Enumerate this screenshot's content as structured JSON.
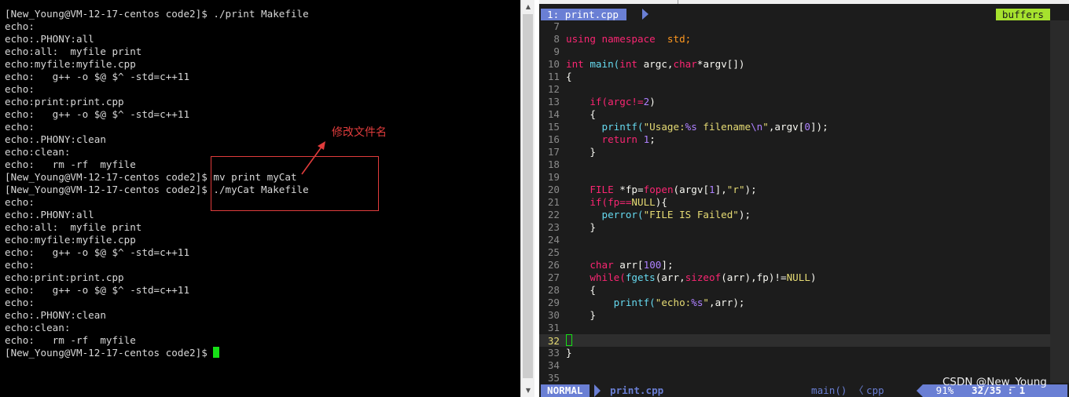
{
  "terminal": {
    "lines": [
      "[New_Young@VM-12-17-centos code2]$ ./print Makefile",
      "echo:",
      "echo:.PHONY:all",
      "echo:all:  myfile print",
      "echo:myfile:myfile.cpp",
      "echo:   g++ -o $@ $^ -std=c++11",
      "echo:",
      "echo:print:print.cpp",
      "echo:   g++ -o $@ $^ -std=c++11",
      "echo:",
      "echo:.PHONY:clean",
      "echo:clean:",
      "echo:   rm -rf  myfile",
      "[New_Young@VM-12-17-centos code2]$ mv print myCat",
      "[New_Young@VM-12-17-centos code2]$ ./myCat Makefile",
      "echo:",
      "echo:.PHONY:all",
      "echo:all:  myfile print",
      "echo:myfile:myfile.cpp",
      "echo:   g++ -o $@ $^ -std=c++11",
      "echo:",
      "echo:print:print.cpp",
      "echo:   g++ -o $@ $^ -std=c++11",
      "echo:",
      "echo:.PHONY:clean",
      "echo:clean:",
      "echo:   rm -rf  myfile",
      "[New_Young@VM-12-17-centos code2]$ "
    ],
    "annotation": "修改文件名",
    "colors": {
      "background": "#000000",
      "text": "#d8d8d8",
      "cursor": "#16e016",
      "annotation": "#e03c3c"
    }
  },
  "vim": {
    "tab": "1: print.cpp",
    "buffers_label": "buffers",
    "code": {
      "l7": "",
      "l8a": "using namespace",
      "l8b": "std;",
      "l10a": "int",
      "l10b": "main(",
      "l10c": "int",
      "l10d": " argc,",
      "l10e": "char",
      "l10f": "*argv[])",
      "l11": "{",
      "l13a": "if(argc!=",
      "l13b": "2",
      "l13c": ")",
      "l14": "{",
      "l15a": "printf(",
      "l15b": "\"Usage:",
      "l15c": "%s",
      "l15d": " filename",
      "l15e": "\\n",
      "l15f": "\"",
      "l15g": ",argv[",
      "l15h": "0",
      "l15i": "]);",
      "l16a": "return",
      "l16b": "1",
      "l16c": ";",
      "l17": "}",
      "l20a": "FILE",
      "l20b": " *fp=",
      "l20c": "fopen",
      "l20d": "(argv[",
      "l20e": "1",
      "l20f": "],",
      "l20g": "\"r\"",
      "l20h": ");",
      "l21a": "if(fp==",
      "l21b": "NULL",
      "l21c": "){",
      "l22a": "perror(",
      "l22b": "\"FILE IS Failed\"",
      "l22c": ");",
      "l23": "}",
      "l26a": "char",
      "l26b": " arr[",
      "l26c": "100",
      "l26d": "];",
      "l27a": "while(",
      "l27b": "fgets",
      "l27c": "(arr,",
      "l27d": "sizeof",
      "l27e": "(arr),fp)!=",
      "l27f": "NULL",
      "l27g": ")",
      "l28": "{",
      "l29a": "printf(",
      "l29b": "\"echo:",
      "l29c": "%s",
      "l29d": "\"",
      "l29e": ",arr);",
      "l30": "}",
      "l33": "}"
    },
    "line_numbers": [
      "7",
      "8",
      "9",
      "10",
      "11",
      "12",
      "13",
      "14",
      "15",
      "16",
      "17",
      "18",
      "19",
      "20",
      "21",
      "22",
      "23",
      "24",
      "25",
      "26",
      "27",
      "28",
      "29",
      "30",
      "31",
      "32",
      "33",
      "34",
      "35"
    ],
    "status": {
      "mode": "NORMAL",
      "filename": "print.cpp",
      "function": "main()",
      "separator": "〈",
      "filetype": "cpp",
      "percent": "91%",
      "position": "32/35 :  1"
    },
    "colors": {
      "background": "#1c1c1c",
      "accent": "#6a7fd4",
      "buffers": "#a6e22e",
      "keyword": "#f92672",
      "function": "#66d9ef",
      "string": "#e6db74",
      "number": "#ae81ff"
    }
  },
  "watermark": "CSDN @New_Young"
}
